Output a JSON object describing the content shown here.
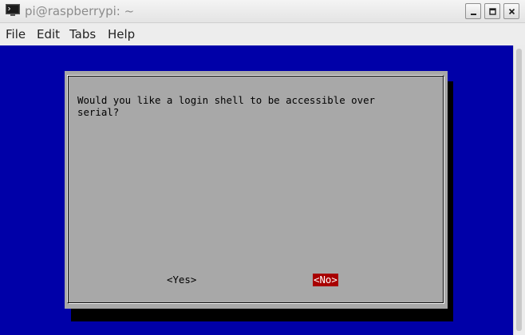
{
  "window": {
    "title": "pi@raspberrypi: ~",
    "title_icon": "terminal-icon",
    "controls": {
      "minimize_icon": "minimize-icon",
      "maximize_icon": "maximize-icon",
      "close_icon": "close-icon"
    }
  },
  "menubar": {
    "items": [
      "File",
      "Edit",
      "Tabs",
      "Help"
    ]
  },
  "terminal": {
    "background": "#0000a8"
  },
  "dialog": {
    "background": "#a8a8a8",
    "prompt_lines": [
      "Would you like a login shell to be accessible over",
      "serial?"
    ],
    "buttons": {
      "yes": "<Yes>",
      "no": "<No>",
      "selected": "no",
      "selected_color": "#a80000"
    }
  }
}
